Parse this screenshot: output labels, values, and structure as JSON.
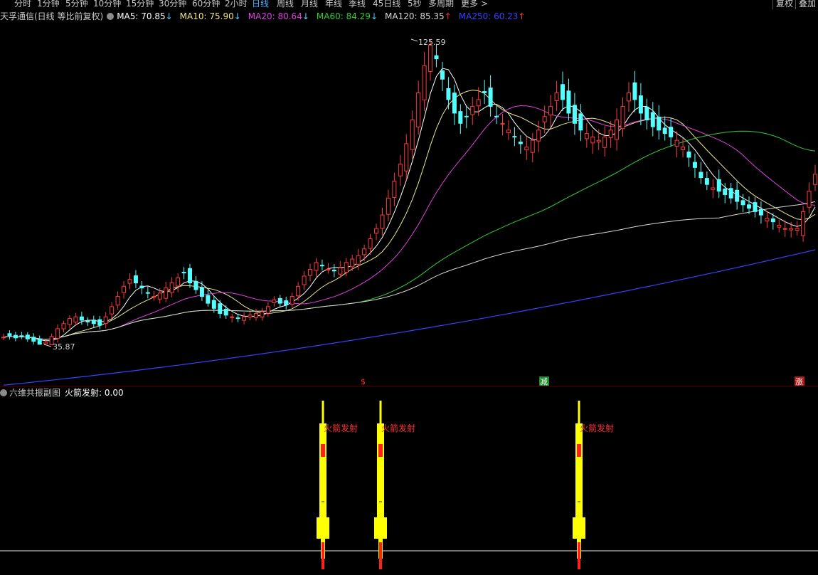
{
  "topbar": {
    "periods": [
      "分时",
      "1分钟",
      "5分钟",
      "10分钟",
      "15分钟",
      "30分钟",
      "60分钟",
      "2小时",
      "日线",
      "周线",
      "月线",
      "年线",
      "季线",
      "45日线",
      "5秒",
      "多周期",
      "更多"
    ],
    "active_index": 8,
    "more_arrow": ">",
    "right_buttons": [
      "复权",
      "叠加"
    ]
  },
  "main_panel": {
    "title": "天孚通信(日线 等比前复权)",
    "ma": [
      {
        "label": "MA5: 70.85",
        "arrow": "↓",
        "color": "#ffffff",
        "arrow_color": "#4fd0ff"
      },
      {
        "label": "MA10: 75.90",
        "arrow": "↓",
        "color": "#f0e68c",
        "arrow_color": "#4fd0ff"
      },
      {
        "label": "MA20: 80.64",
        "arrow": "↓",
        "color": "#e040e0",
        "arrow_color": "#4fd0ff"
      },
      {
        "label": "MA60: 84.29",
        "arrow": "↓",
        "color": "#33cc33",
        "arrow_color": "#4fd0ff"
      },
      {
        "label": "MA120: 85.35",
        "arrow": "↑",
        "color": "#d8d8d8",
        "arrow_color": "#ff3030"
      },
      {
        "label": "MA250: 60.23",
        "arrow": "↑",
        "color": "#3344ff",
        "arrow_color": "#ff3030"
      }
    ],
    "high_label": "125.59",
    "low_label": "35.87",
    "markers": [
      {
        "text": "$",
        "color": "#ff3030",
        "bg": "#000000"
      },
      {
        "text": "减",
        "color": "#ffffff",
        "bg": "#1f8a2a"
      },
      {
        "text": "涨",
        "color": "#ffffff",
        "bg": "#b01818"
      }
    ]
  },
  "sub_panel": {
    "title": "六维共振副图",
    "indicator": "火箭发射: 0.00",
    "rocket_label": "火箭发射",
    "rocket_count": 3
  },
  "chart_data": {
    "type": "candlestick",
    "title": "天孚通信(日线 等比前复权)",
    "y_annotations": {
      "high": 125.59,
      "low": 35.87
    },
    "ma_series": [
      {
        "name": "MA5",
        "last": 70.85,
        "color": "#ffffff"
      },
      {
        "name": "MA10",
        "last": 75.9,
        "color": "#f0e68c"
      },
      {
        "name": "MA20",
        "last": 80.64,
        "color": "#e040e0"
      },
      {
        "name": "MA60",
        "last": 84.29,
        "color": "#33cc33"
      },
      {
        "name": "MA120",
        "last": 85.35,
        "color": "#d8d8d8"
      },
      {
        "name": "MA250",
        "last": 60.23,
        "color": "#3344ff"
      }
    ],
    "close_series": [
      38,
      38.5,
      37.8,
      38.2,
      37.5,
      36.8,
      35.9,
      36.5,
      38.2,
      40.5,
      42,
      43.5,
      44,
      43,
      42.5,
      42,
      41.5,
      44,
      47,
      50,
      53,
      55,
      54,
      52.5,
      51,
      50,
      51,
      52.5,
      54,
      55.5,
      57,
      54,
      52,
      50,
      48,
      46.5,
      45,
      44.5,
      44,
      43.5,
      44,
      44.5,
      45,
      45.5,
      47,
      49,
      48,
      47.5,
      50,
      53,
      56,
      58,
      60,
      59,
      58,
      57.5,
      58.5,
      60,
      61,
      62,
      64,
      67,
      70,
      74,
      79,
      84,
      89,
      95,
      102,
      110,
      118,
      124,
      120,
      114,
      108,
      104,
      101,
      103,
      106,
      108,
      110,
      106,
      103,
      101,
      99,
      97,
      95,
      94,
      96,
      99,
      103,
      106,
      110,
      108,
      104,
      101,
      99,
      98,
      97,
      96,
      97,
      99,
      102,
      106,
      110,
      108,
      104,
      102,
      100,
      99,
      98,
      97,
      96,
      94,
      91,
      88,
      85,
      83,
      82,
      81,
      80,
      79,
      78,
      77,
      76,
      75,
      74,
      73,
      72,
      71,
      70,
      70,
      70,
      75,
      81,
      86
    ],
    "sub_indicator": {
      "name": "火箭发射",
      "value": 0.0
    }
  }
}
